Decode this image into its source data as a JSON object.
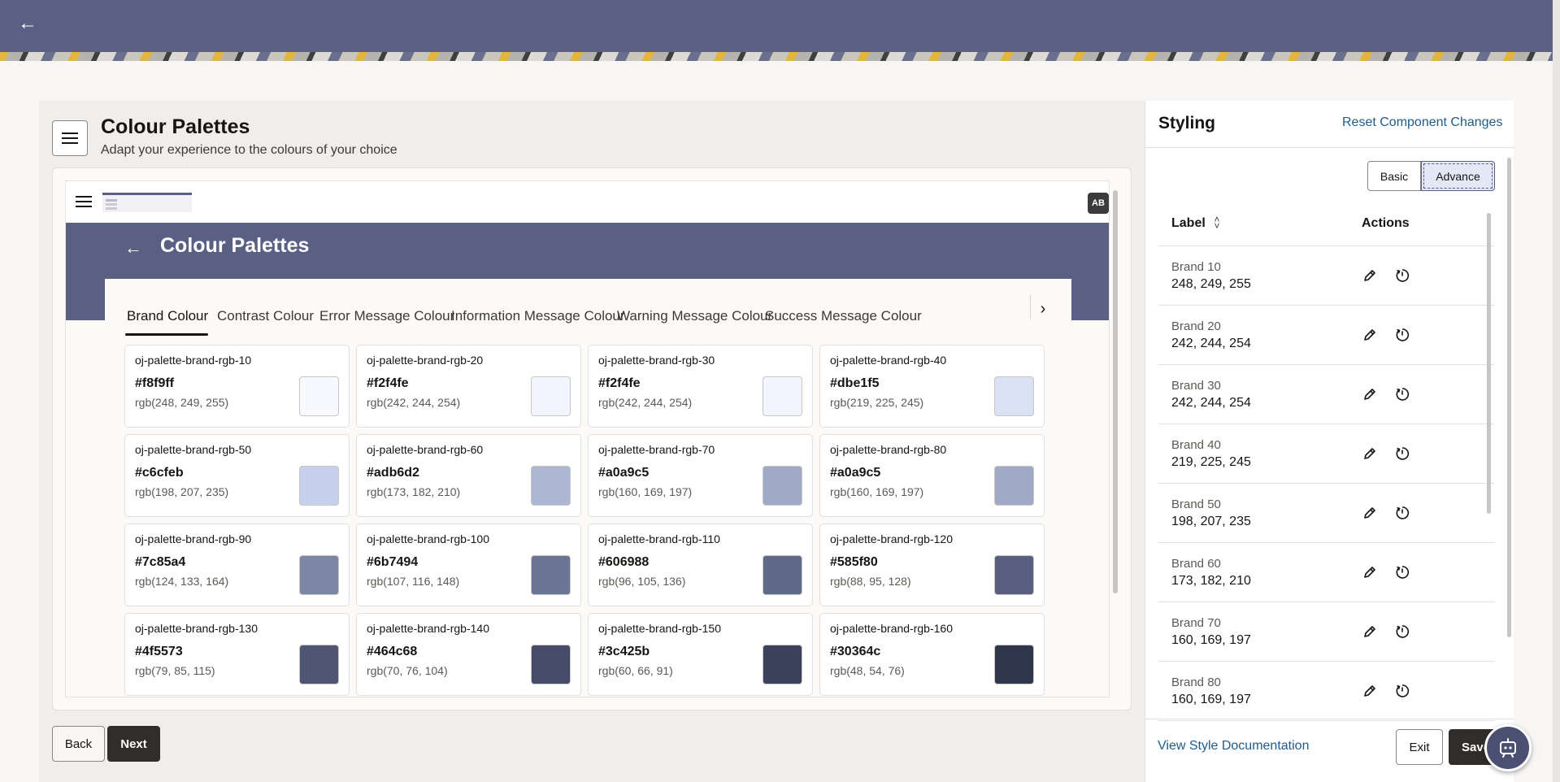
{
  "header": {
    "back_icon": "←"
  },
  "page": {
    "title": "Colour Palettes",
    "subtitle": "Adapt your experience to the colours of your choice"
  },
  "preview": {
    "avatar": "AB",
    "back_icon": "←",
    "title": "Colour Palettes",
    "tabs": [
      {
        "label": "Brand Colour",
        "active": true
      },
      {
        "label": "Contrast Colour",
        "active": false
      },
      {
        "label": "Error Message Colour",
        "active": false
      },
      {
        "label": "Information Message Colour",
        "active": false
      },
      {
        "label": "Warning Message Colour",
        "active": false
      },
      {
        "label": "Success Message Colour",
        "active": false
      }
    ],
    "tab_next_icon": "›",
    "cards": [
      {
        "token": "oj-palette-brand-rgb-10",
        "hex": "#f8f9ff",
        "rgb": "rgb(248, 249, 255)"
      },
      {
        "token": "oj-palette-brand-rgb-20",
        "hex": "#f2f4fe",
        "rgb": "rgb(242, 244, 254)"
      },
      {
        "token": "oj-palette-brand-rgb-30",
        "hex": "#f2f4fe",
        "rgb": "rgb(242, 244, 254)"
      },
      {
        "token": "oj-palette-brand-rgb-40",
        "hex": "#dbe1f5",
        "rgb": "rgb(219, 225, 245)"
      },
      {
        "token": "oj-palette-brand-rgb-50",
        "hex": "#c6cfeb",
        "rgb": "rgb(198, 207, 235)"
      },
      {
        "token": "oj-palette-brand-rgb-60",
        "hex": "#adb6d2",
        "rgb": "rgb(173, 182, 210)"
      },
      {
        "token": "oj-palette-brand-rgb-70",
        "hex": "#a0a9c5",
        "rgb": "rgb(160, 169, 197)"
      },
      {
        "token": "oj-palette-brand-rgb-80",
        "hex": "#a0a9c5",
        "rgb": "rgb(160, 169, 197)"
      },
      {
        "token": "oj-palette-brand-rgb-90",
        "hex": "#7c85a4",
        "rgb": "rgb(124, 133, 164)"
      },
      {
        "token": "oj-palette-brand-rgb-100",
        "hex": "#6b7494",
        "rgb": "rgb(107, 116, 148)"
      },
      {
        "token": "oj-palette-brand-rgb-110",
        "hex": "#606988",
        "rgb": "rgb(96, 105, 136)"
      },
      {
        "token": "oj-palette-brand-rgb-120",
        "hex": "#585f80",
        "rgb": "rgb(88, 95, 128)"
      },
      {
        "token": "oj-palette-brand-rgb-130",
        "hex": "#4f5573",
        "rgb": "rgb(79, 85, 115)"
      },
      {
        "token": "oj-palette-brand-rgb-140",
        "hex": "#464c68",
        "rgb": "rgb(70, 76, 104)"
      },
      {
        "token": "oj-palette-brand-rgb-150",
        "hex": "#3c425b",
        "rgb": "rgb(60, 66, 91)"
      },
      {
        "token": "oj-palette-brand-rgb-160",
        "hex": "#30364c",
        "rgb": "rgb(48, 54, 76)"
      }
    ]
  },
  "footer": {
    "back_label": "Back",
    "next_label": "Next"
  },
  "styling": {
    "title": "Styling",
    "reset_label": "Reset Component Changes",
    "mode_basic": "Basic",
    "mode_advance": "Advance",
    "selected_mode": "Advance",
    "col_label": "Label",
    "col_actions": "Actions",
    "rows": [
      {
        "label": "Brand 10",
        "value": "248, 249, 255"
      },
      {
        "label": "Brand 20",
        "value": "242, 244, 254"
      },
      {
        "label": "Brand 30",
        "value": "242, 244, 254"
      },
      {
        "label": "Brand 40",
        "value": "219, 225, 245"
      },
      {
        "label": "Brand 50",
        "value": "198, 207, 235"
      },
      {
        "label": "Brand 60",
        "value": "173, 182, 210"
      },
      {
        "label": "Brand 70",
        "value": "160, 169, 197"
      },
      {
        "label": "Brand 80",
        "value": "160, 169, 197"
      }
    ],
    "doc_link": "View Style Documentation",
    "exit_label": "Exit",
    "save_label": "Save"
  },
  "colors": {
    "header_bg": "#5a6084",
    "primary_button": "#312d2a",
    "link": "#1f5b8e"
  }
}
